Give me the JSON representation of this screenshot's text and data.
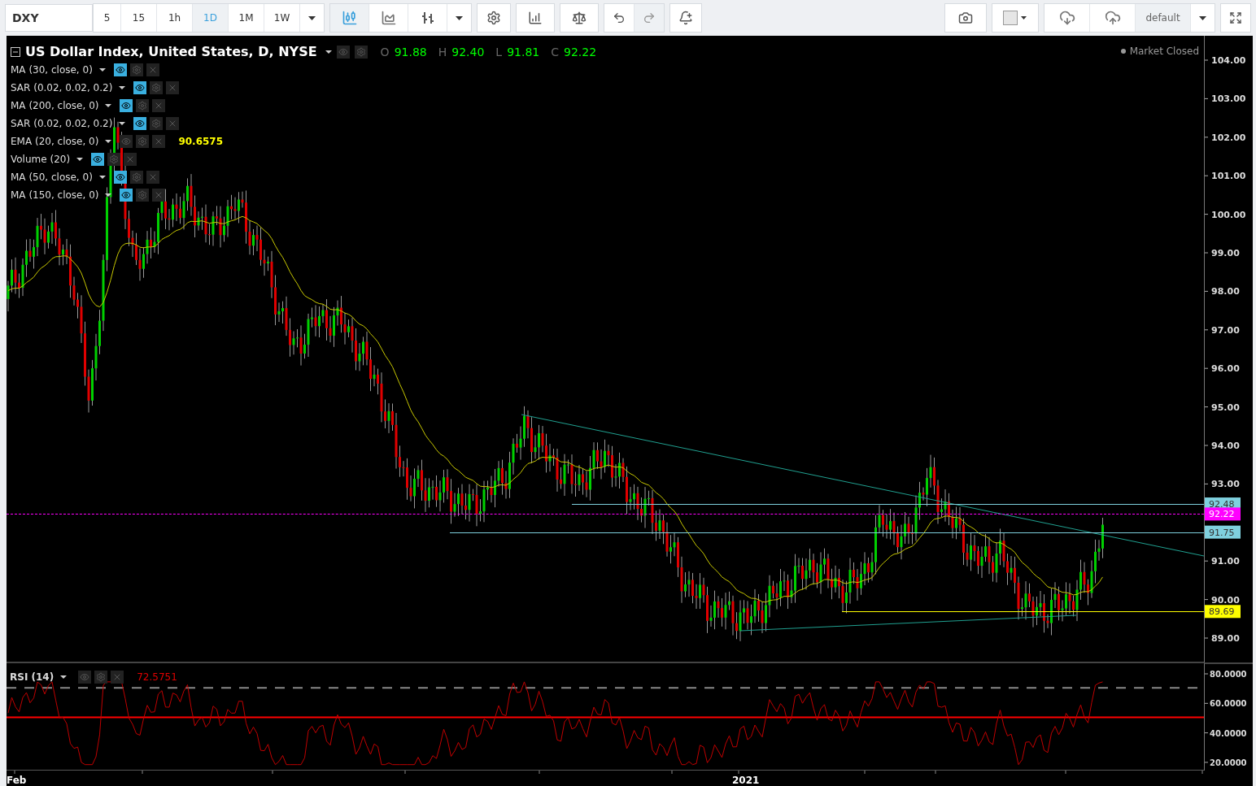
{
  "toolbar": {
    "symbol": "DXY",
    "intervals": [
      {
        "label": "5",
        "selected": false
      },
      {
        "label": "15",
        "selected": false
      },
      {
        "label": "1h",
        "selected": false
      },
      {
        "label": "1D",
        "selected": true
      },
      {
        "label": "1M",
        "selected": false
      },
      {
        "label": "1W",
        "selected": false
      }
    ],
    "chart_types": [
      {
        "selected": true
      },
      {
        "selected": false
      },
      {
        "selected": false
      }
    ],
    "layout": "default"
  },
  "chart": {
    "title": "US Dollar Index, United States, D, NYSE",
    "ohlc": [
      {
        "label": "O",
        "value": "91.88"
      },
      {
        "label": "H",
        "value": "92.40"
      },
      {
        "label": "L",
        "value": "91.81"
      },
      {
        "label": "C",
        "value": "92.22"
      }
    ],
    "indicators": [
      {
        "name": "MA (30, close, 0)",
        "visible": true
      },
      {
        "name": "SAR (0.02, 0.02, 0.2)",
        "visible": true
      },
      {
        "name": "MA (200, close, 0)",
        "visible": true
      },
      {
        "name": "SAR (0.02, 0.02, 0.2)",
        "visible": true
      },
      {
        "name": "EMA (20, close, 0)",
        "visible": false,
        "value": "90.6575"
      },
      {
        "name": "Volume (20)",
        "visible": true
      },
      {
        "name": "MA (50, close, 0)",
        "visible": true
      },
      {
        "name": "MA (150, close, 0)",
        "visible": true
      }
    ],
    "market_status": "Market Closed",
    "price_ticks": [
      "104.00",
      "103.00",
      "102.00",
      "101.00",
      "100.00",
      "99.00",
      "98.00",
      "97.00",
      "96.00",
      "95.00",
      "94.00",
      "93.00",
      "91.00",
      "90.00",
      "89.00"
    ],
    "levels": [
      {
        "label": "92.48",
        "color": "#7fd0de"
      },
      {
        "label": "92.22",
        "color": "#ff00ff"
      },
      {
        "label": "91.75",
        "color": "#7fd0de"
      },
      {
        "label": "89.69",
        "color": "#ffff00"
      }
    ]
  },
  "rsi": {
    "name": "RSI (14)",
    "visible": false,
    "value": "72.5751",
    "ticks": [
      "80.0000",
      "60.0000",
      "40.0000",
      "20.0000"
    ]
  },
  "time_axis": [
    "Feb",
    "2021"
  ]
}
